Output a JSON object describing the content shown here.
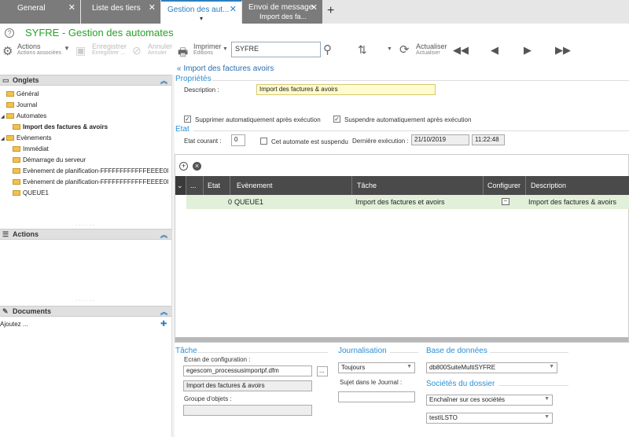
{
  "tabs": [
    {
      "label": "General",
      "active": false
    },
    {
      "label": "Liste des tiers",
      "active": false
    },
    {
      "label": "Gestion des aut...",
      "active": true
    },
    {
      "label": "Envoi de message",
      "sub": "Import des fa...",
      "active": false
    }
  ],
  "tab_add": "+",
  "app": {
    "title": "SYFRE - Gestion des automates",
    "help": "?"
  },
  "toolbar": {
    "actions_label": "Actions",
    "actions_sub": "Actions associées",
    "save_label": "Enregistrer",
    "save_sub": "Enregistrer ...",
    "cancel_label": "Annuler",
    "cancel_sub": "Annuler",
    "print_label": "Imprimer",
    "print_sub": "Editions",
    "search_value": "SYFRE",
    "refresh_label": "Actualiser",
    "refresh_sub": "Actualiser"
  },
  "left": {
    "onglets_title": "Onglets",
    "tree": [
      {
        "label": "Général"
      },
      {
        "label": "Journal"
      },
      {
        "label": "Automates"
      },
      {
        "label": "Import des factures & avoirs"
      },
      {
        "label": "Evènements"
      },
      {
        "label": "Immédiat"
      },
      {
        "label": "Démarrage du serveur"
      },
      {
        "label": "Evènement de planification-FFFFFFFFFFFFEEEE0I"
      },
      {
        "label": "Evènement de planification-FFFFFFFFFFFFEEEE0I"
      },
      {
        "label": "QUEUE1"
      }
    ],
    "actions_title": "Actions",
    "documents_title": "Documents",
    "documents_add": "Ajoutez ..."
  },
  "main": {
    "back_link": "Import des factures avoirs",
    "proprietes_title": "Propriétés",
    "description_label": "Description :",
    "description_value": "Import des factures & avoirs",
    "cb_delete_label": "Supprimer automatiquement après exécution",
    "cb_suspend_label": "Suspendre automatiquement après exécution",
    "etat_title": "Etat",
    "etat_courant_label": "Etat courant :",
    "etat_courant_value": "0",
    "cb_suspendu_label": "Cet automate est suspendu",
    "last_exec_label": "Dernière exécution :",
    "last_exec_date": "21/10/2019",
    "last_exec_time": "11:22:48",
    "grid_headers": [
      "...",
      "Etat",
      "Evènement",
      "Tâche",
      "Configurer",
      "Description"
    ],
    "grid_rows": [
      {
        "etat": "0",
        "evenement": "QUEUE1",
        "tache": "Import des factures et avoirs",
        "description": "Import des factures & avoirs"
      }
    ],
    "tache_title": "Tâche",
    "ecran_label": "Ecran de configuration :",
    "ecran_value": "egescom_processusimportpf.dfm",
    "ecran_name": "Import des factures & avoirs",
    "groupe_label": "Groupe d'objets :",
    "groupe_value": "",
    "ellipsis": "...",
    "journal_title": "Journalisation",
    "journal_value": "Toujours",
    "sujet_label": "Sujet dans le Journal :",
    "sujet_value": "",
    "db_title": "Base de données",
    "db_value": "db800SuiteMultiSYFRE",
    "societes_title": "Sociétés du dossier",
    "societes_mode": "Enchaîner sur ces sociétés",
    "societe_value": "testILSTO"
  }
}
